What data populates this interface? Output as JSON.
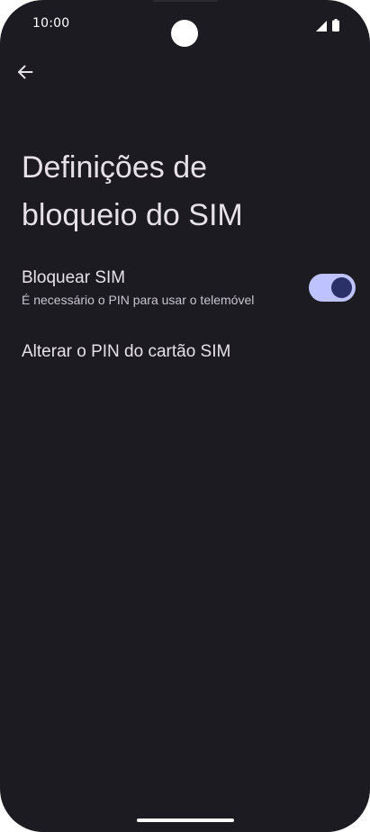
{
  "status_bar": {
    "time": "10:00",
    "signal_icon": "signal-icon",
    "battery_icon": "battery-icon"
  },
  "navigation": {
    "back_icon": "arrow-back-icon"
  },
  "page": {
    "title_line1": "Definições de",
    "title_line2": "bloqueio do SIM"
  },
  "preferences": {
    "lock_sim": {
      "title": "Bloquear SIM",
      "summary": "É necessário o PIN para usar o telemóvel",
      "enabled": true
    },
    "change_pin": {
      "title": "Alterar o PIN do cartão SIM"
    }
  },
  "colors": {
    "background": "#1c1b21",
    "text_primary": "#e6e1e9",
    "text_secondary": "#c9c5d0",
    "toggle_track": "#bec2ff",
    "toggle_thumb": "#2a3169"
  }
}
